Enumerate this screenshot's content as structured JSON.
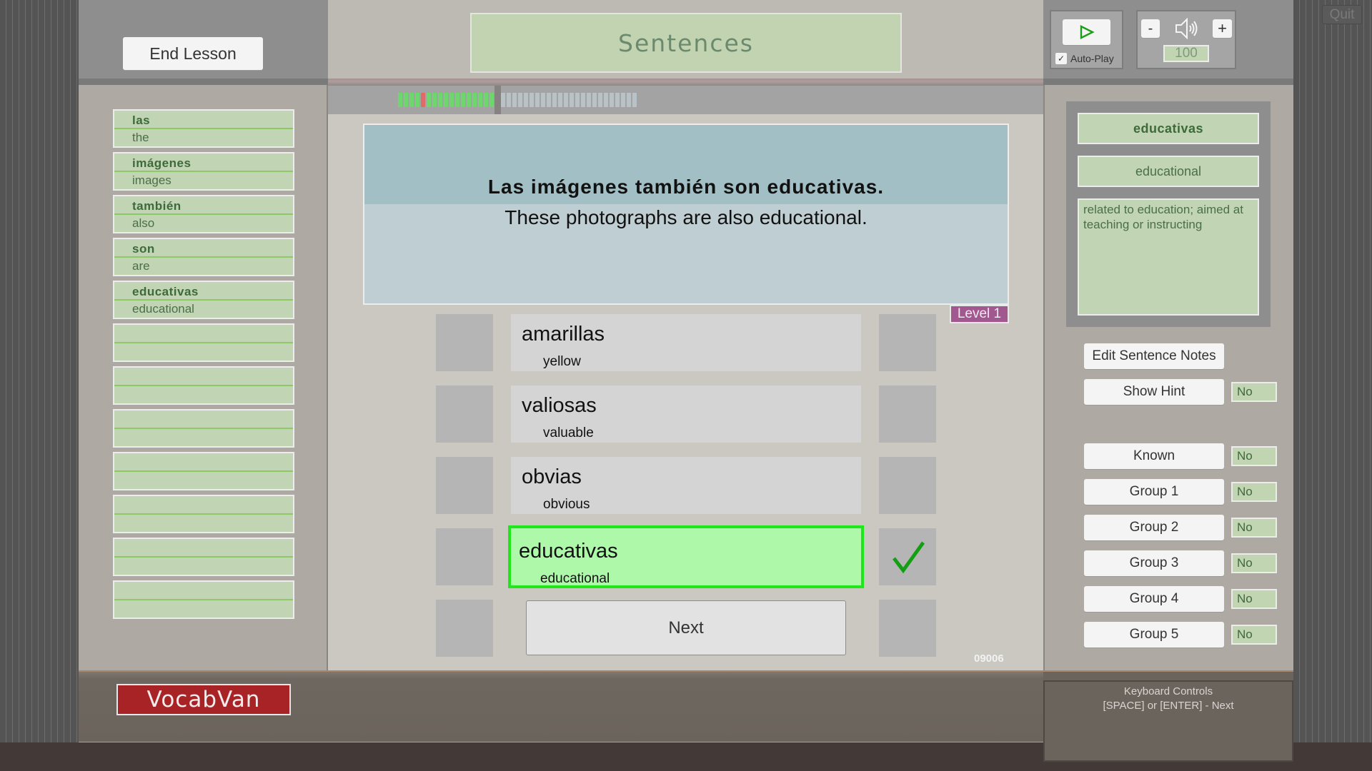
{
  "app": {
    "name": "VocabVan"
  },
  "header": {
    "end_lesson_label": "End Lesson",
    "title": "Sentences",
    "quit_label": "Quit"
  },
  "progress": {
    "total_segments": 42,
    "segments": [
      "done",
      "done",
      "done",
      "done",
      "wrong",
      "done",
      "done",
      "done",
      "done",
      "done",
      "done",
      "done",
      "done",
      "done",
      "done",
      "done",
      "done",
      "done"
    ],
    "current_index": 17
  },
  "word_list": {
    "items": [
      {
        "es": "las",
        "en": "the"
      },
      {
        "es": "imágenes",
        "en": "images"
      },
      {
        "es": "también",
        "en": "also"
      },
      {
        "es": "son",
        "en": "are"
      },
      {
        "es": "educativas",
        "en": "educational"
      },
      {
        "es": "",
        "en": ""
      },
      {
        "es": "",
        "en": ""
      },
      {
        "es": "",
        "en": ""
      },
      {
        "es": "",
        "en": ""
      },
      {
        "es": "",
        "en": ""
      },
      {
        "es": "",
        "en": ""
      },
      {
        "es": "",
        "en": ""
      }
    ]
  },
  "sentence": {
    "spanish": "Las imágenes también son educativas.",
    "english": "These photographs are also educational.",
    "level": "Level 1",
    "id": "09006"
  },
  "answers": [
    {
      "es": "amarillas",
      "en": "yellow",
      "state": "normal"
    },
    {
      "es": "valiosas",
      "en": "valuable",
      "state": "normal"
    },
    {
      "es": "obvias",
      "en": "obvious",
      "state": "normal"
    },
    {
      "es": "educativas",
      "en": "educational",
      "state": "correct"
    }
  ],
  "next_label": "Next",
  "audio": {
    "autoplay_label": "Auto-Play",
    "autoplay_checked": true,
    "volume": "100",
    "minus_label": "-",
    "plus_label": "+"
  },
  "detail": {
    "es": "educativas",
    "en": "educational",
    "definition": "related to education; aimed at teaching or instructing"
  },
  "side_buttons": {
    "edit_notes_label": "Edit Sentence Notes",
    "show_hint": {
      "label": "Show Hint",
      "value": "No"
    },
    "flags": [
      {
        "label": "Known",
        "value": "No"
      },
      {
        "label": "Group 1",
        "value": "No"
      },
      {
        "label": "Group 2",
        "value": "No"
      },
      {
        "label": "Group 3",
        "value": "No"
      },
      {
        "label": "Group 4",
        "value": "No"
      },
      {
        "label": "Group 5",
        "value": "No"
      }
    ]
  },
  "keyboard": {
    "title": "Keyboard Controls",
    "lines": [
      "[SPACE] or [ENTER] - Next"
    ]
  },
  "colors": {
    "correct_border": "#1ee81a",
    "correct_fill": "#aef8aa",
    "check": "#12a012",
    "progress_done": "#6cd86c",
    "progress_wrong": "#e06a6a",
    "progress_todo": "#b9c2c6",
    "level_badge": "#a0588e",
    "logo": "#a82325"
  }
}
